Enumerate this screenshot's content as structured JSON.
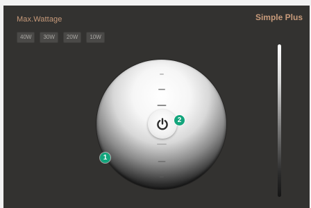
{
  "header": {
    "title": "Max.Wattage",
    "brand": "Simple Plus"
  },
  "wattage_options": [
    "40W",
    "30W",
    "20W",
    "10W"
  ],
  "badges": [
    "1",
    "2"
  ],
  "icons": {
    "power": "power-icon"
  },
  "colors": {
    "accent": "#c89b7b",
    "badge": "#13a57c",
    "panel": "#333230"
  }
}
